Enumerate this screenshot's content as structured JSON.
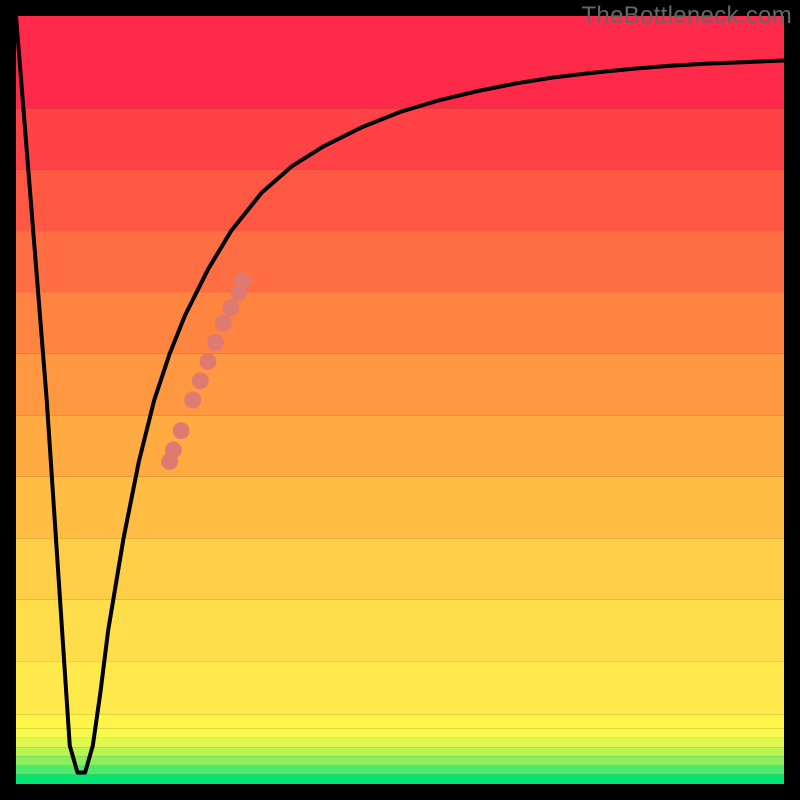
{
  "credit": "TheBottleneck.com",
  "chart_data": {
    "type": "line",
    "title": "",
    "xlabel": "",
    "ylabel": "",
    "xlim": [
      0,
      100
    ],
    "ylim": [
      0,
      100
    ],
    "grid": false,
    "gradient_bands": [
      {
        "color": "#00e676",
        "y0": 0.0,
        "y1": 1.2
      },
      {
        "color": "#4ceb6b",
        "y0": 1.2,
        "y1": 2.4
      },
      {
        "color": "#8af05f",
        "y0": 2.4,
        "y1": 3.6
      },
      {
        "color": "#b9f455",
        "y0": 3.6,
        "y1": 4.8
      },
      {
        "color": "#dff74e",
        "y0": 4.8,
        "y1": 6.0
      },
      {
        "color": "#f8f94a",
        "y0": 6.0,
        "y1": 7.2
      },
      {
        "color": "#fff44a",
        "y0": 7.2,
        "y1": 9.0
      },
      {
        "color": "#ffe94b",
        "y0": 9.0,
        "y1": 16.0
      },
      {
        "color": "#ffdd4b",
        "y0": 16.0,
        "y1": 24.0
      },
      {
        "color": "#ffcf48",
        "y0": 24.0,
        "y1": 32.0
      },
      {
        "color": "#ffbd44",
        "y0": 32.0,
        "y1": 40.0
      },
      {
        "color": "#ffab41",
        "y0": 40.0,
        "y1": 48.0
      },
      {
        "color": "#ff9840",
        "y0": 48.0,
        "y1": 56.0
      },
      {
        "color": "#ff8440",
        "y0": 56.0,
        "y1": 64.0
      },
      {
        "color": "#ff6e42",
        "y0": 64.0,
        "y1": 72.0
      },
      {
        "color": "#ff5944",
        "y0": 72.0,
        "y1": 80.0
      },
      {
        "color": "#ff4246",
        "y0": 80.0,
        "y1": 88.0
      },
      {
        "color": "#ff2a49",
        "y0": 88.0,
        "y1": 100.0
      }
    ],
    "series": [
      {
        "name": "curve",
        "x": [
          0.0,
          2.0,
          4.0,
          6.0,
          7.0,
          8.0,
          9.0,
          10.0,
          11.0,
          12.0,
          14.0,
          16.0,
          18.0,
          20.0,
          22.0,
          25.0,
          28.0,
          32.0,
          36.0,
          40.0,
          45.0,
          50.0,
          55.0,
          60.0,
          65.0,
          70.0,
          75.0,
          80.0,
          85.0,
          90.0,
          95.0,
          100.0
        ],
        "y": [
          100.0,
          75.0,
          50.0,
          20.0,
          5.0,
          1.5,
          1.5,
          5.0,
          12.0,
          20.0,
          32.0,
          42.0,
          50.0,
          56.0,
          61.0,
          67.0,
          72.0,
          77.0,
          80.5,
          83.0,
          85.5,
          87.5,
          89.0,
          90.2,
          91.2,
          92.0,
          92.6,
          93.1,
          93.5,
          93.8,
          94.0,
          94.2
        ]
      }
    ],
    "scatter_points": {
      "color": "#df7a72",
      "radius_pct": 1.1,
      "points": [
        {
          "x": 20.0,
          "y": 42.0
        },
        {
          "x": 20.5,
          "y": 43.5
        },
        {
          "x": 21.5,
          "y": 46.0
        },
        {
          "x": 23.0,
          "y": 50.0
        },
        {
          "x": 24.0,
          "y": 52.5
        },
        {
          "x": 25.0,
          "y": 55.0
        },
        {
          "x": 26.0,
          "y": 57.5
        },
        {
          "x": 27.0,
          "y": 60.0
        },
        {
          "x": 28.0,
          "y": 62.0
        },
        {
          "x": 29.0,
          "y": 64.0
        },
        {
          "x": 29.5,
          "y": 65.5
        }
      ]
    }
  }
}
